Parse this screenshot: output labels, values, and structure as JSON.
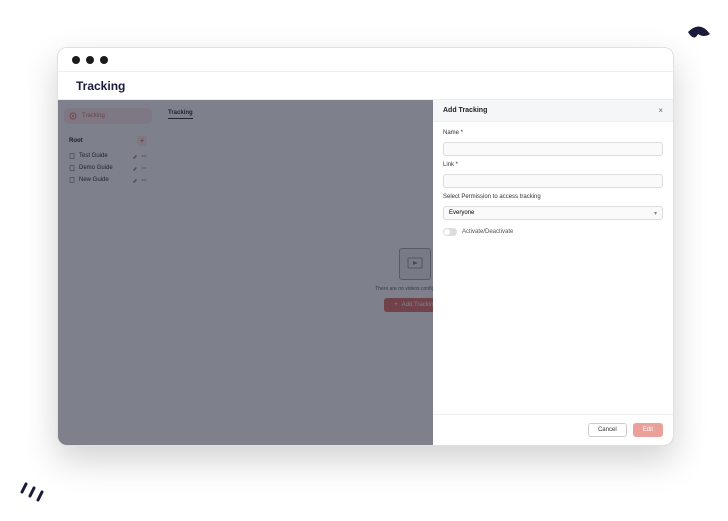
{
  "page": {
    "title": "Tracking"
  },
  "sidebar": {
    "nav_active": "Tracking",
    "section_label": "Root",
    "items": [
      {
        "label": "Test Guide"
      },
      {
        "label": "Demo Guide"
      },
      {
        "label": "New Guide"
      }
    ]
  },
  "main": {
    "tab_label": "Tracking",
    "empty_text": "There are no videos configured here",
    "add_button_label": "Add Tracking"
  },
  "drawer": {
    "title": "Add Tracking",
    "fields": {
      "name_label": "Name *",
      "link_label": "Link *",
      "permission_label": "Select Permission to access tracking",
      "permission_selected": "Everyone",
      "toggle_label": "Activate/Deactivate"
    },
    "footer": {
      "cancel": "Cancel",
      "submit": "Edit"
    }
  },
  "icons": {
    "plus": "+",
    "close": "×",
    "caret": "▾"
  }
}
